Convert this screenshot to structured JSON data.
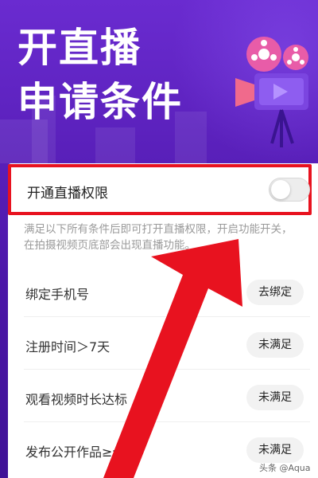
{
  "hero": {
    "title_line1": "开直播",
    "title_line2": "申请条件"
  },
  "permission": {
    "label": "开通直播权限",
    "toggle_state": "off"
  },
  "description": "满足以下所有条件后即可打开直播权限，开启功能开关，在拍摄视频页底部会出现直播功能。",
  "conditions": [
    {
      "label": "绑定手机号",
      "action": "去绑定"
    },
    {
      "label": "注册时间＞7天",
      "action": "未满足"
    },
    {
      "label": "观看视频时长达标",
      "action": "未满足"
    },
    {
      "label": "发布公开作品≥个",
      "action": "未满足"
    }
  ],
  "watermark": "头条 @Aqua",
  "colors": {
    "hero_bg": "#5a1fc0",
    "highlight_red": "#e8121f",
    "arrow_red": "#e8121f"
  }
}
